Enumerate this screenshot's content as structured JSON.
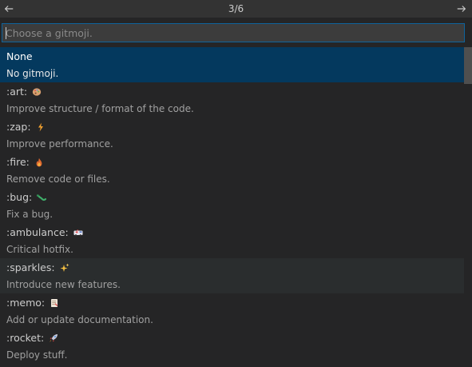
{
  "header": {
    "step": "3/6"
  },
  "input": {
    "placeholder": "Choose a gitmoji.",
    "value": ""
  },
  "items": [
    {
      "label": "None",
      "emoji": "",
      "detail": "No gitmoji."
    },
    {
      "label": ":art:",
      "emoji": "art-icon",
      "detail": "Improve structure / format of the code."
    },
    {
      "label": ":zap:",
      "emoji": "zap-icon",
      "detail": "Improve performance."
    },
    {
      "label": ":fire:",
      "emoji": "fire-icon",
      "detail": "Remove code or files."
    },
    {
      "label": ":bug:",
      "emoji": "bug-icon",
      "detail": "Fix a bug."
    },
    {
      "label": ":ambulance:",
      "emoji": "ambulance-icon",
      "detail": "Critical hotfix."
    },
    {
      "label": ":sparkles:",
      "emoji": "sparkles-icon",
      "detail": "Introduce new features."
    },
    {
      "label": ":memo:",
      "emoji": "memo-icon",
      "detail": "Add or update documentation."
    },
    {
      "label": ":rocket:",
      "emoji": "rocket-icon",
      "detail": "Deploy stuff."
    }
  ],
  "colors": {
    "selected_bg": "#04395e",
    "hover_bg": "#2a2d2e",
    "focus_border": "#0e639c"
  }
}
